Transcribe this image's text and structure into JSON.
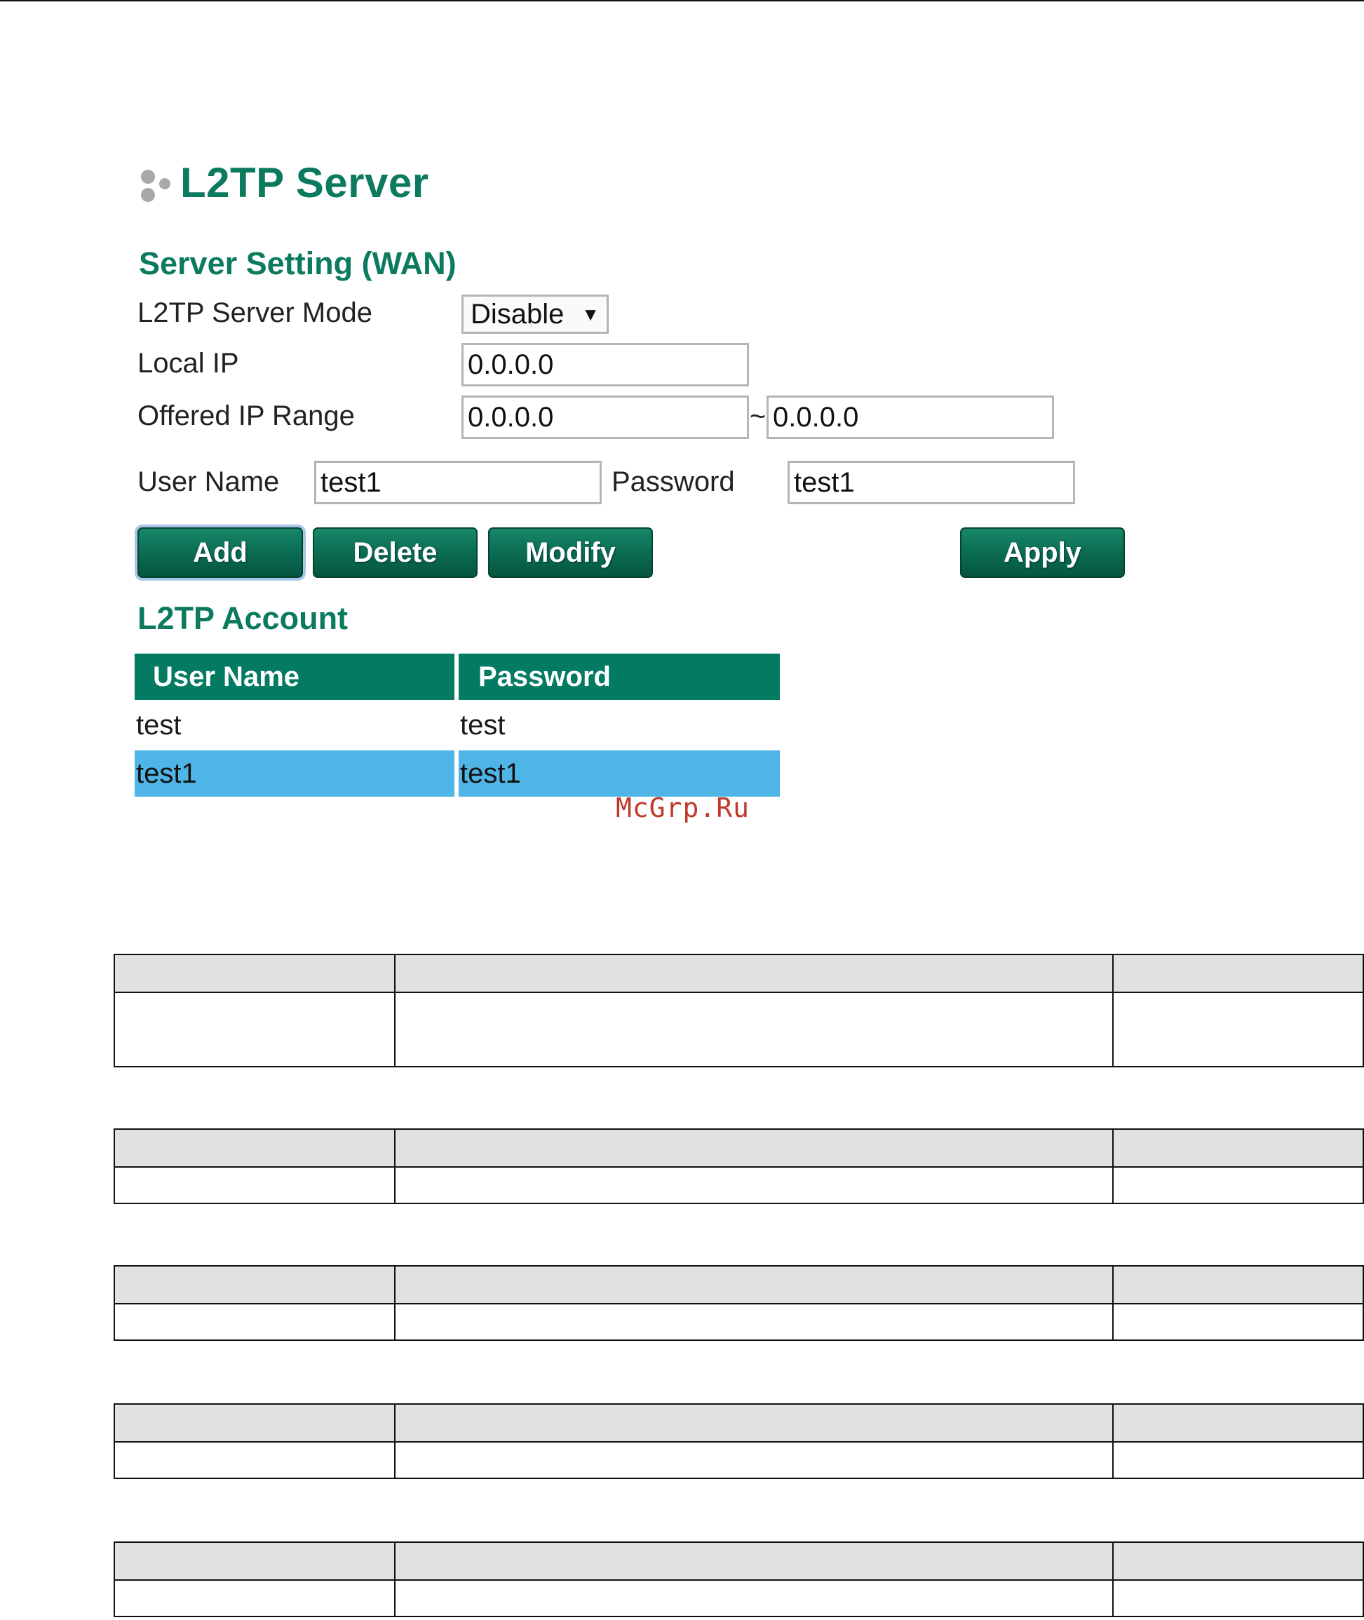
{
  "title": "L2TP Server",
  "server_setting": {
    "heading": "Server Setting (WAN)",
    "mode_label": "L2TP Server Mode",
    "mode_value": "Disable",
    "local_ip_label": "Local IP",
    "local_ip_value": "0.0.0.0",
    "offered_range_label": "Offered IP Range",
    "range_start": "0.0.0.0",
    "range_separator": "~",
    "range_end": "0.0.0.0"
  },
  "account_form": {
    "username_label": "User Name",
    "username_value": "test1",
    "password_label": "Password",
    "password_value": "test1"
  },
  "buttons": {
    "add": "Add",
    "delete": "Delete",
    "modify": "Modify",
    "apply": "Apply"
  },
  "account_table": {
    "heading": "L2TP Account",
    "columns": [
      "User Name",
      "Password"
    ],
    "rows": [
      {
        "username": "test",
        "password": "test",
        "selected": false
      },
      {
        "username": "test1",
        "password": "test1",
        "selected": true
      }
    ]
  },
  "watermark": "McGrp.Ru",
  "colors": {
    "accent": "#0b7a5e",
    "header_bg": "#037a62",
    "selected_row": "#4fb5e6",
    "table_header_gray": "#e1e1e1"
  }
}
